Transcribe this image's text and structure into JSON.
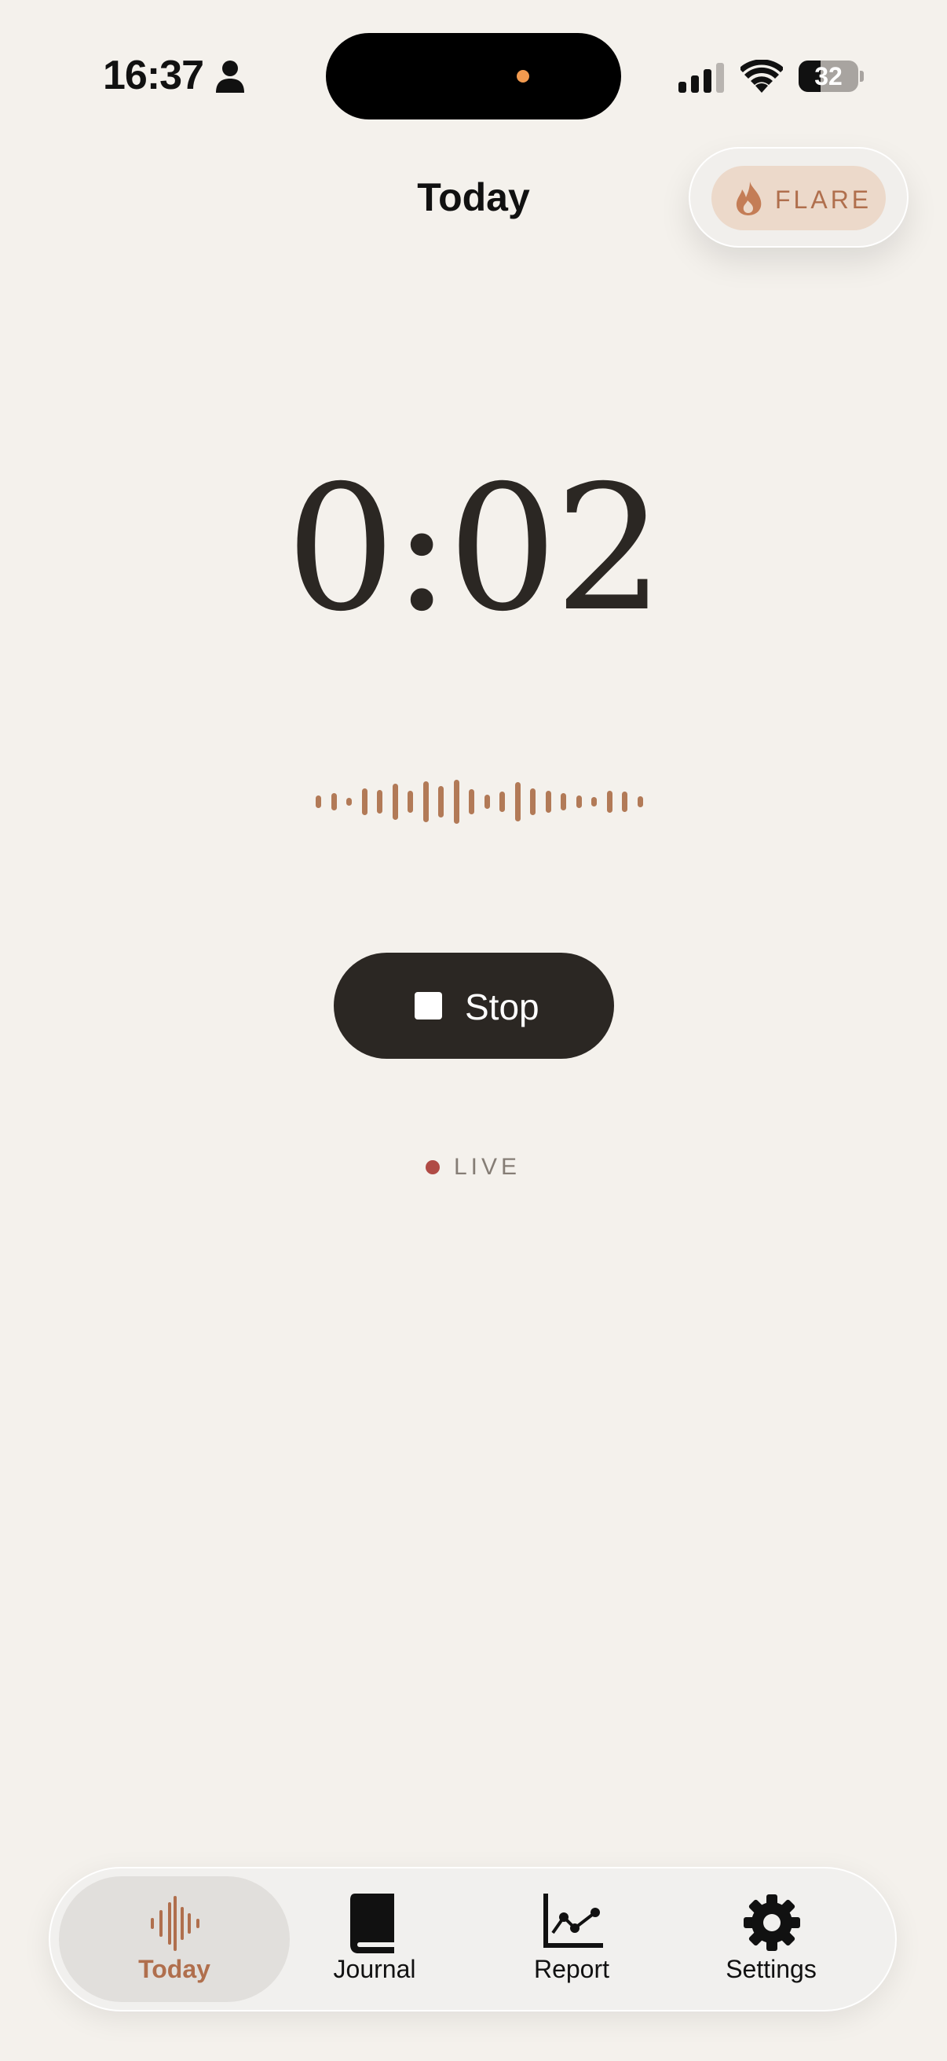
{
  "status_bar": {
    "time": "16:37",
    "battery": "32"
  },
  "header": {
    "title": "Today"
  },
  "flare_button": {
    "label": "FLARE"
  },
  "recorder": {
    "elapsed": "0:02",
    "stop_label": "Stop",
    "status": "LIVE"
  },
  "tab_bar": {
    "tabs": [
      {
        "label": "Today",
        "icon": "waveform-icon",
        "active": true
      },
      {
        "label": "Journal",
        "icon": "book-icon",
        "active": false
      },
      {
        "label": "Report",
        "icon": "line-chart-icon",
        "active": false
      },
      {
        "label": "Settings",
        "icon": "gear-icon",
        "active": false
      }
    ]
  },
  "colors": {
    "background": "#f4f1ec",
    "accent": "#b06f4d",
    "dark": "#2b2723",
    "live_dot": "#b04b45"
  }
}
